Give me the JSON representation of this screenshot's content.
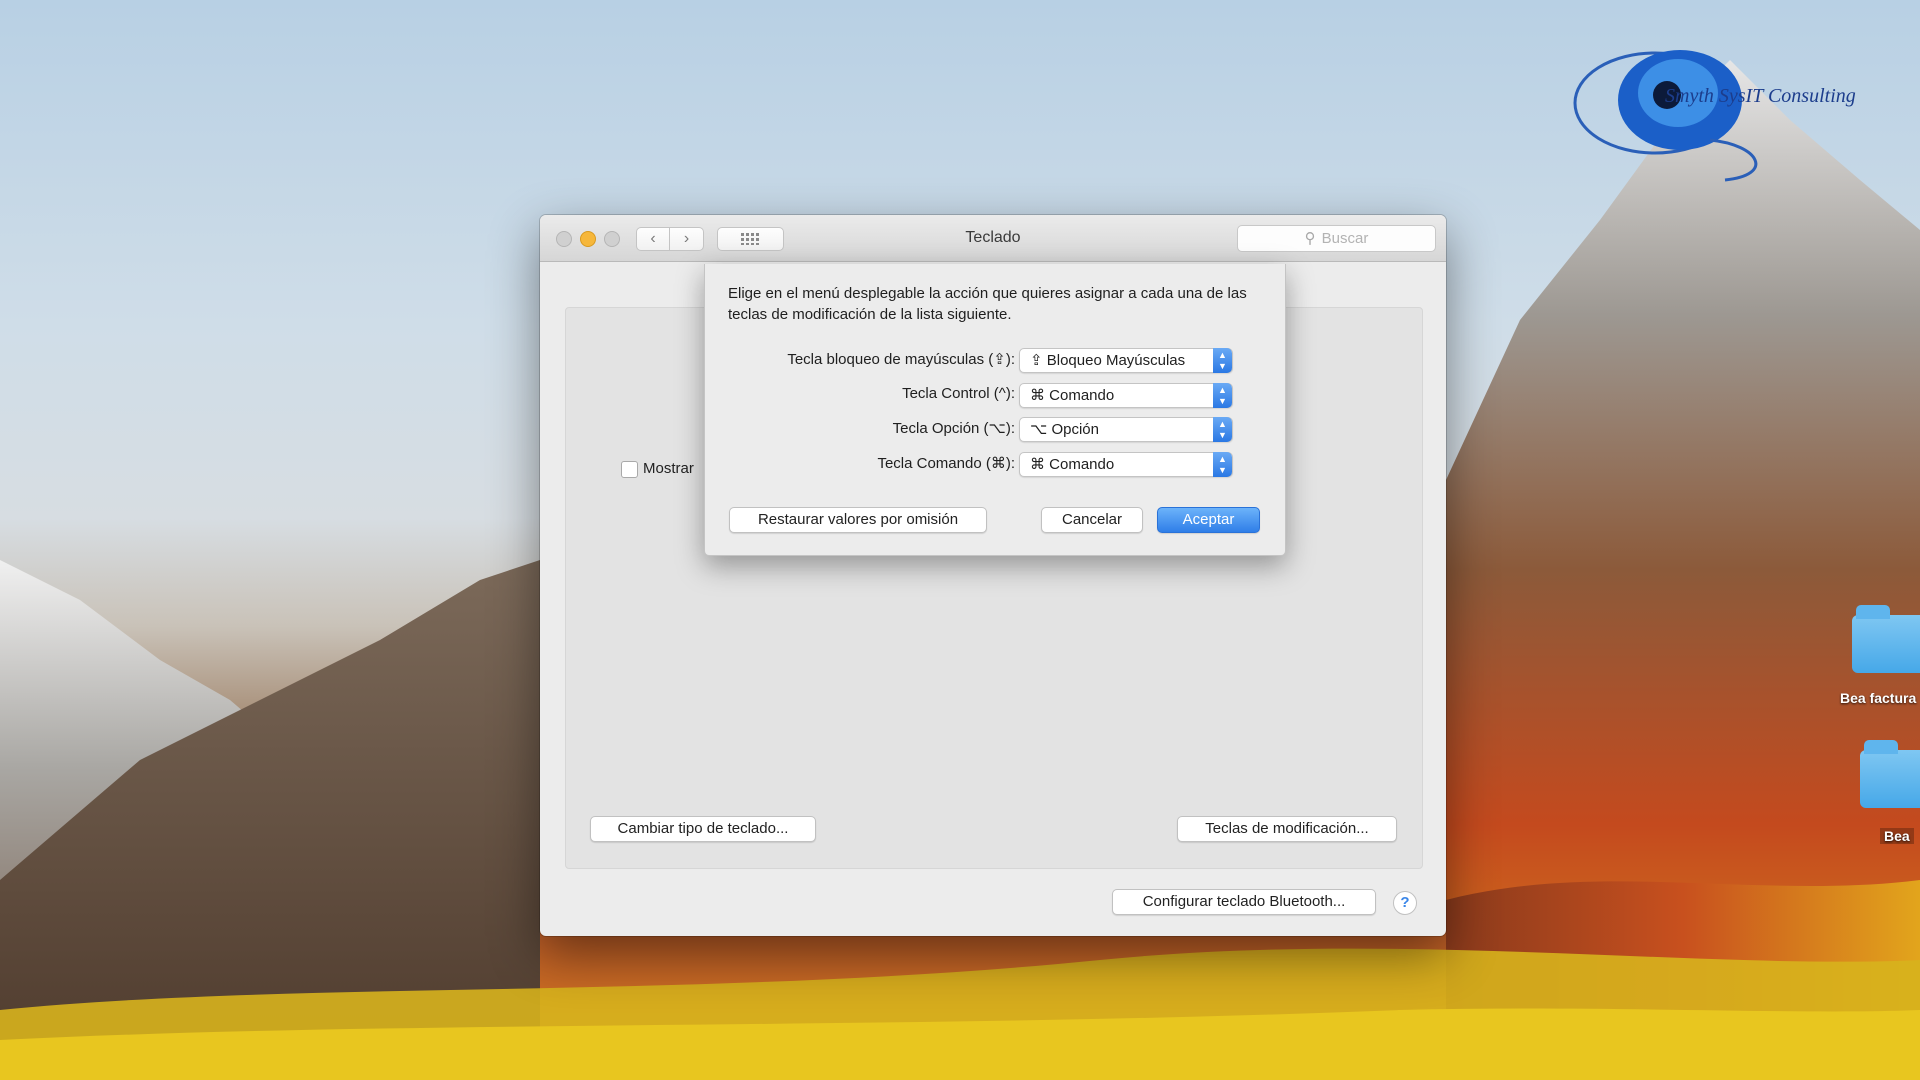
{
  "window": {
    "title": "Teclado",
    "search_placeholder": "Buscar",
    "nav_back_icon": "chevron-left-icon",
    "nav_forward_icon": "chevron-right-icon",
    "grid_icon": "grid-icon",
    "checkbox_label": "Mostrar",
    "change_keyboard_type": "Cambiar tipo de teclado...",
    "modifier_keys": "Teclas de modificación...",
    "bluetooth_setup": "Configurar teclado Bluetooth...",
    "help": "?"
  },
  "sheet": {
    "message": "Elige en el menú desplegable la acción que quieres asignar a cada una de las teclas de modificación de la lista siguiente.",
    "rows": [
      {
        "label": "Tecla bloqueo de mayúsculas (⇪):",
        "value": "⇪ Bloqueo Mayúsculas"
      },
      {
        "label": "Tecla Control (^):",
        "value": "⌘ Comando"
      },
      {
        "label": "Tecla Opción (⌥):",
        "value": "⌥ Opción"
      },
      {
        "label": "Tecla Comando (⌘):",
        "value": "⌘ Comando"
      }
    ],
    "restore_defaults": "Restaurar valores por omisión",
    "cancel": "Cancelar",
    "accept": "Aceptar"
  },
  "desktop": {
    "logo_text": "Smyth SysIT Consulting",
    "folders": [
      {
        "label": "Bea factura"
      },
      {
        "label": "Bea"
      }
    ]
  },
  "colors": {
    "accent": "#2f7ee8",
    "minimize": "#f6b73b"
  }
}
